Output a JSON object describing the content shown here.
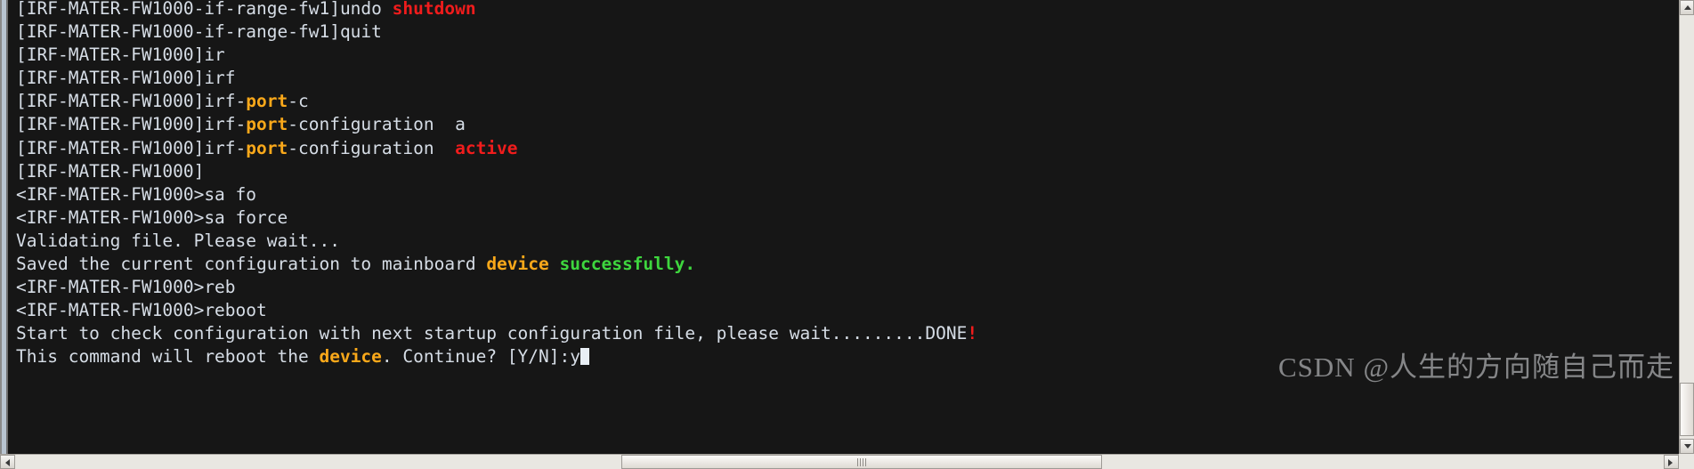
{
  "window": {
    "kind": "ssh-terminal",
    "background_color": "#161616",
    "foreground_color": "#d6dde6",
    "chrome_color": "#d4d0c8"
  },
  "palette": {
    "default": "#d6dde6",
    "keyword_orange": "#f9a81a",
    "value_red": "#f01c1c",
    "success_green": "#3ed63e"
  },
  "terminal": {
    "lines": [
      {
        "id": "line-01",
        "clipped": true,
        "segments": [
          {
            "text": "[IRF-MATER-FW1000-if-range-fw1]undo ",
            "color": "default"
          },
          {
            "text": "shutdown",
            "color": "value_red"
          }
        ]
      },
      {
        "id": "line-02",
        "segments": [
          {
            "text": "[IRF-MATER-FW1000-if-range-fw1]quit",
            "color": "default"
          }
        ]
      },
      {
        "id": "line-03",
        "segments": [
          {
            "text": "[IRF-MATER-FW1000]ir",
            "color": "default"
          }
        ]
      },
      {
        "id": "line-04",
        "segments": [
          {
            "text": "[IRF-MATER-FW1000]irf",
            "color": "default"
          }
        ]
      },
      {
        "id": "line-05",
        "segments": [
          {
            "text": "[IRF-MATER-FW1000]irf-",
            "color": "default"
          },
          {
            "text": "port",
            "color": "keyword_orange"
          },
          {
            "text": "-c",
            "color": "default"
          }
        ]
      },
      {
        "id": "line-06",
        "segments": [
          {
            "text": "[IRF-MATER-FW1000]irf-",
            "color": "default"
          },
          {
            "text": "port",
            "color": "keyword_orange"
          },
          {
            "text": "-configuration  a",
            "color": "default"
          }
        ]
      },
      {
        "id": "line-07",
        "segments": [
          {
            "text": "[IRF-MATER-FW1000]irf-",
            "color": "default"
          },
          {
            "text": "port",
            "color": "keyword_orange"
          },
          {
            "text": "-configuration  ",
            "color": "default"
          },
          {
            "text": "active",
            "color": "value_red"
          }
        ]
      },
      {
        "id": "line-08",
        "segments": [
          {
            "text": "[IRF-MATER-FW1000]",
            "color": "default"
          }
        ]
      },
      {
        "id": "line-09",
        "segments": [
          {
            "text": "<IRF-MATER-FW1000>sa fo",
            "color": "default"
          }
        ]
      },
      {
        "id": "line-10",
        "segments": [
          {
            "text": "<IRF-MATER-FW1000>sa force",
            "color": "default"
          }
        ]
      },
      {
        "id": "line-11",
        "segments": [
          {
            "text": "Validating file. Please wait...",
            "color": "default"
          }
        ]
      },
      {
        "id": "line-12",
        "segments": [
          {
            "text": "Saved the current configuration to mainboard ",
            "color": "default"
          },
          {
            "text": "device",
            "color": "keyword_orange"
          },
          {
            "text": " ",
            "color": "default"
          },
          {
            "text": "successfully.",
            "color": "success_green"
          }
        ]
      },
      {
        "id": "line-13",
        "segments": [
          {
            "text": "<IRF-MATER-FW1000>reb",
            "color": "default"
          }
        ]
      },
      {
        "id": "line-14",
        "segments": [
          {
            "text": "<IRF-MATER-FW1000>reboot",
            "color": "default"
          }
        ]
      },
      {
        "id": "line-15",
        "segments": [
          {
            "text": "Start to check configuration with next startup configuration file, please wait.........DONE",
            "color": "default"
          },
          {
            "text": "!",
            "color": "value_red"
          }
        ]
      },
      {
        "id": "line-16",
        "segments": [
          {
            "text": "This command will reboot the ",
            "color": "default"
          },
          {
            "text": "device",
            "color": "keyword_orange"
          },
          {
            "text": ". Continue? [Y/N]:y",
            "color": "default"
          }
        ],
        "cursor": true
      }
    ]
  },
  "watermark": {
    "text": "CSDN @人生的方向随自己而走"
  },
  "scrollbars": {
    "vertical": {
      "up_label": "▲",
      "down_label": "▼"
    },
    "horizontal": {
      "left_label": "◀",
      "right_label": "▶"
    }
  }
}
